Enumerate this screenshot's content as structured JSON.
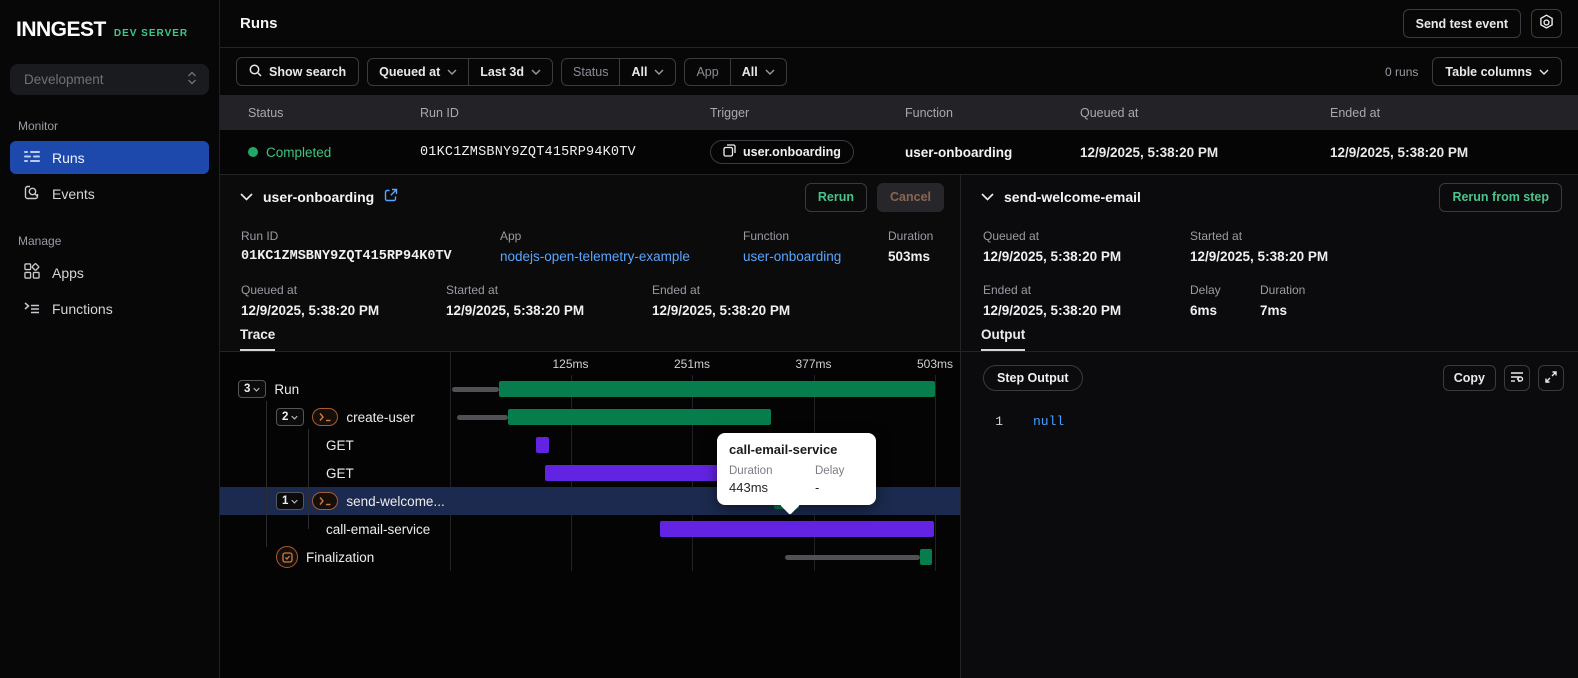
{
  "colors": {
    "accent_blue": "#1e49ac",
    "link_blue": "#58a6ff",
    "success_green": "#077d4d",
    "step_purple": "#6323e3",
    "status_green": "#3fc47c",
    "brand_green": "#3ec98a",
    "step_orange": "#cf7c42"
  },
  "sidebar": {
    "logo": "INNGEST",
    "env_badge": "DEV SERVER",
    "environment": "Development",
    "sections": [
      {
        "label": "Monitor",
        "items": [
          {
            "label": "Runs",
            "icon": "runs-icon",
            "active": true
          },
          {
            "label": "Events",
            "icon": "events-icon",
            "active": false
          }
        ]
      },
      {
        "label": "Manage",
        "items": [
          {
            "label": "Apps",
            "icon": "apps-icon",
            "active": false
          },
          {
            "label": "Functions",
            "icon": "functions-icon",
            "active": false
          }
        ]
      }
    ]
  },
  "topbar": {
    "title": "Runs",
    "send_test_event": "Send test event"
  },
  "filters": {
    "show_search": "Show search",
    "time_field": "Queued at",
    "time_range": "Last 3d",
    "status_label": "Status",
    "status_value": "All",
    "app_label": "App",
    "app_value": "All",
    "runs_count": "0 runs",
    "table_columns": "Table columns"
  },
  "table": {
    "columns": [
      "Status",
      "Run ID",
      "Trigger",
      "Function",
      "Queued at",
      "Ended at"
    ],
    "row": {
      "status": "Completed",
      "run_id": "01KC1ZMSBNY9ZQT415RP94K0TV",
      "trigger": "user.onboarding",
      "function": "user-onboarding",
      "queued_at": "12/9/2025, 5:38:20 PM",
      "ended_at": "12/9/2025, 5:38:20 PM"
    }
  },
  "run_detail": {
    "title": "user-onboarding",
    "rerun": "Rerun",
    "cancel": "Cancel",
    "run_id_label": "Run ID",
    "run_id": "01KC1ZMSBNY9ZQT415RP94K0TV",
    "app_label": "App",
    "app": "nodejs-open-telemetry-example",
    "function_label": "Function",
    "function": "user-onboarding",
    "duration_label": "Duration",
    "duration": "503ms",
    "queued_at_label": "Queued at",
    "queued_at": "12/9/2025, 5:38:20 PM",
    "started_at_label": "Started at",
    "started_at": "12/9/2025, 5:38:20 PM",
    "ended_at_label": "Ended at",
    "ended_at": "12/9/2025, 5:38:20 PM",
    "tab": "Trace"
  },
  "trace": {
    "total_ms": 503,
    "ticks": [
      {
        "label": "125ms",
        "ms": 125
      },
      {
        "label": "251ms",
        "ms": 251
      },
      {
        "label": "377ms",
        "ms": 377
      },
      {
        "label": "503ms",
        "ms": 503
      }
    ],
    "rows": [
      {
        "badge": "3",
        "label": "Run",
        "level": 0,
        "highlighted": false,
        "bars": [
          {
            "kind": "queue",
            "start": 2,
            "end": 51
          },
          {
            "kind": "success",
            "start": 51,
            "end": 503
          }
        ]
      },
      {
        "badge": "2",
        "icon": "step-icon",
        "label": "create-user",
        "level": 1,
        "highlighted": false,
        "bars": [
          {
            "kind": "queue",
            "start": 7,
            "end": 60
          },
          {
            "kind": "success",
            "start": 60,
            "end": 333
          }
        ]
      },
      {
        "label": "GET",
        "level": 2,
        "highlighted": false,
        "bars": [
          {
            "kind": "http",
            "start": 89,
            "end": 103
          }
        ]
      },
      {
        "label": "GET",
        "level": 2,
        "highlighted": false,
        "bars": [
          {
            "kind": "http",
            "start": 99,
            "end": 300
          }
        ]
      },
      {
        "badge": "1",
        "icon": "step-icon",
        "label": "send-welcome...",
        "level": 1,
        "highlighted": true,
        "bars": [
          {
            "kind": "success",
            "start": 336,
            "end": 362
          }
        ]
      },
      {
        "label": "call-email-service",
        "level": 2,
        "highlighted": false,
        "bars": [
          {
            "kind": "http",
            "start": 218,
            "end": 502
          }
        ]
      },
      {
        "icon": "finalization-icon",
        "label": "Finalization",
        "level": 1,
        "highlighted": false,
        "bars": [
          {
            "kind": "queue",
            "start": 347,
            "end": 487
          },
          {
            "kind": "success",
            "start": 487,
            "end": 500
          }
        ]
      }
    ],
    "tooltip": {
      "title": "call-email-service",
      "duration_label": "Duration",
      "duration": "443ms",
      "delay_label": "Delay",
      "delay": "-"
    }
  },
  "step_detail": {
    "title": "send-welcome-email",
    "rerun_from_step": "Rerun from step",
    "queued_at_label": "Queued at",
    "queued_at": "12/9/2025, 5:38:20 PM",
    "started_at_label": "Started at",
    "started_at": "12/9/2025, 5:38:20 PM",
    "ended_at_label": "Ended at",
    "ended_at": "12/9/2025, 5:38:20 PM",
    "delay_label": "Delay",
    "delay": "6ms",
    "duration_label": "Duration",
    "duration": "7ms",
    "tab": "Output",
    "output_badge": "Step Output",
    "copy": "Copy",
    "line_number": "1",
    "code": "null"
  }
}
